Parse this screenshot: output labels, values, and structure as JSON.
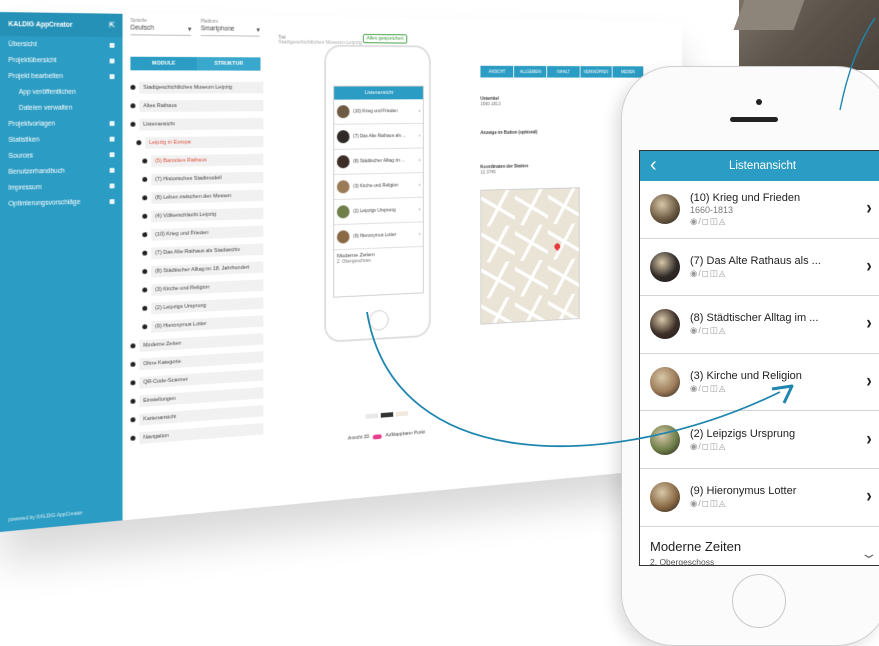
{
  "sidebar": {
    "app_title": "KALDIG AppCreator",
    "items": [
      {
        "label": "Übersicht",
        "indent": false
      },
      {
        "label": "Projektübersicht",
        "indent": false
      },
      {
        "label": "Projekt bearbeiten",
        "indent": false
      },
      {
        "label": "App veröffentlichen",
        "indent": true
      },
      {
        "label": "Dateien verwalten",
        "indent": true
      },
      {
        "label": "Projektvorlagen",
        "indent": false
      },
      {
        "label": "Statistiken",
        "indent": false
      },
      {
        "label": "Sources",
        "indent": false
      },
      {
        "label": "Benutzerhandbuch",
        "indent": false
      },
      {
        "label": "Impressum",
        "indent": false
      },
      {
        "label": "Optimierungsvorschläge",
        "indent": false
      }
    ],
    "footer": "powered by KALDIG AppCreator"
  },
  "editor": {
    "language_label": "Sprache",
    "language_value": "Deutsch",
    "platform_label": "Plattform",
    "platform_value": "Smartphone",
    "title_label": "Titel",
    "title_placeholder": "Stadtgeschichtliches Museum Leipzig",
    "saved_label": "Alles gespeichert",
    "tabs": [
      "MODULE",
      "STRUKTUR"
    ],
    "tree": [
      {
        "label": "Stadtgeschichtliches Museum Leipzig",
        "red": false
      },
      {
        "label": "Altes Rathaus",
        "red": false
      },
      {
        "label": "Listenansicht",
        "red": false
      },
      {
        "label": "Leipzig in Europa",
        "red": true
      },
      {
        "label": "(5) Barockes Rathaus",
        "red": true
      },
      {
        "label": "(7) Historisches Stadtmodell",
        "red": false
      },
      {
        "label": "(8) Leben zwischen den Messen",
        "red": false
      },
      {
        "label": "(4) Völkerschlacht Leipzig",
        "red": false
      },
      {
        "label": "(10) Krieg und Frieden",
        "red": false
      },
      {
        "label": "(7) Das Alte Rathaus als Stadtarchiv",
        "red": false
      },
      {
        "label": "(8) Städtischer Alltag im 18. Jahrhundert",
        "red": false
      },
      {
        "label": "(3) Kirche und Religion",
        "red": false
      },
      {
        "label": "(2) Leipzigs Ursprung",
        "red": false
      },
      {
        "label": "(9) Hieronymus Lotter",
        "red": false
      },
      {
        "label": "Moderne Zeiten",
        "red": false
      },
      {
        "label": "Ohne Kategorie",
        "red": false
      },
      {
        "label": "QR-Code-Scanner",
        "red": false
      },
      {
        "label": "Einstellungen",
        "red": false
      },
      {
        "label": "Kartenansicht",
        "red": false
      },
      {
        "label": "Navigation",
        "red": false
      }
    ],
    "right_tabs": [
      "ANSICHT",
      "ALLGEMEIN",
      "INHALT",
      "VERKNÜPFEN",
      "MEDIEN"
    ],
    "right_fields": [
      {
        "label": "Untertitel",
        "value": "1660-1813"
      },
      {
        "label": "Anzeige im Button (optional)",
        "value": ""
      },
      {
        "label": "Koordinaten der Station",
        "value": "12.3746"
      }
    ],
    "toggle_label": "Ansicht 3D",
    "toggle_label_2": "Aufklappbarer Punkt"
  },
  "small_phone": {
    "title": "Listenansicht",
    "rows": [
      "(10) Krieg und Frieden",
      "(7) Das Alte Rathaus als ...",
      "(8) Städtischer Alltag im ...",
      "(3) Kirche und Religion",
      "(2) Leipzigs Ursprung",
      "(9) Hieronymus Lotter"
    ],
    "section": "Moderne Zeiten",
    "section_sub": "2. Obergeschoss"
  },
  "big_phone": {
    "header_title": "Listenansicht",
    "back_icon": "chevron-left-icon",
    "items": [
      {
        "title": "(10) Krieg und Frieden",
        "subtitle": "1660-1813",
        "meta": "◉/◻︎◫◬",
        "thumb": "#6e5b44"
      },
      {
        "title": "(7) Das Alte Rathaus als ...",
        "subtitle": "",
        "meta": "◉/◻︎◫◬",
        "thumb": "#2f2a27"
      },
      {
        "title": "(8) Städtischer Alltag im ...",
        "subtitle": "",
        "meta": "◉/◻︎◫◬",
        "thumb": "#3d2f28"
      },
      {
        "title": "(3) Kirche und Religion",
        "subtitle": "",
        "meta": "◉/◻︎◫◬",
        "thumb": "#9b7a57"
      },
      {
        "title": "(2) Leipzigs Ursprung",
        "subtitle": "",
        "meta": "◉/◻︎◫◬",
        "thumb": "#6f7f4a"
      },
      {
        "title": "(9) Hieronymus Lotter",
        "subtitle": "",
        "meta": "◉/◻︎◫◬",
        "thumb": "#8a6a45"
      }
    ],
    "section_title": "Moderne Zeiten",
    "section_subtitle": "2. Obergeschoss"
  },
  "colors": {
    "accent": "#2b9cc3",
    "arrow": "#1f86b0",
    "danger": "#e0523f"
  }
}
